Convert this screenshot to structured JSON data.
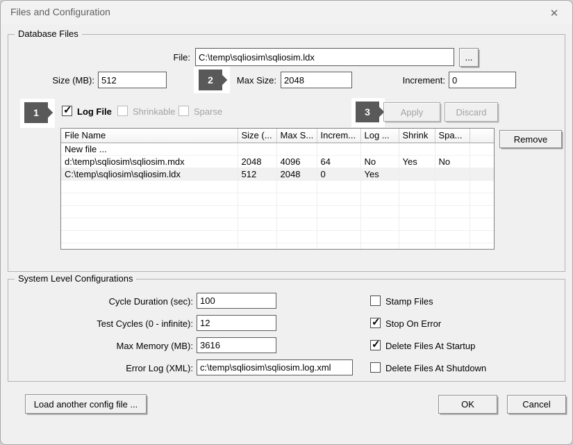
{
  "window": {
    "title": "Files and Configuration",
    "close_glyph": "✕"
  },
  "callouts": {
    "one": "1",
    "two": "2",
    "three": "3"
  },
  "database_files": {
    "group_label": "Database Files",
    "file_label": "File:",
    "file_value": "C:\\temp\\sqliosim\\sqliosim.ldx",
    "browse_label": "...",
    "size_label": "Size (MB):",
    "size_value": "512",
    "max_size_label": "Max Size:",
    "max_size_value": "2048",
    "increment_label": "Increment:",
    "increment_value": "0",
    "log_file_label": "Log File",
    "shrinkable_label": "Shrinkable",
    "sparse_label": "Sparse",
    "apply_label": "Apply",
    "discard_label": "Discard",
    "remove_label": "Remove",
    "table": {
      "columns": [
        "File Name",
        "Size (...",
        "Max S...",
        "Increm...",
        "Log ...",
        "Shrink",
        "Spa...",
        ""
      ],
      "rows": [
        {
          "cells": [
            "New file ...",
            "",
            "",
            "",
            "",
            "",
            "",
            ""
          ],
          "selected": false
        },
        {
          "cells": [
            "d:\\temp\\sqliosim\\sqliosim.mdx",
            "2048",
            "4096",
            "64",
            "No",
            "Yes",
            "No",
            ""
          ],
          "selected": false
        },
        {
          "cells": [
            "C:\\temp\\sqliosim\\sqliosim.ldx",
            "512",
            "2048",
            "0",
            "Yes",
            "",
            "",
            ""
          ],
          "selected": true
        }
      ]
    }
  },
  "system_config": {
    "group_label": "System Level Configurations",
    "fields": [
      {
        "label": "Cycle Duration (sec):",
        "value": "100"
      },
      {
        "label": "Test Cycles (0 - infinite):",
        "value": "12"
      },
      {
        "label": "Max Memory (MB):",
        "value": "3616"
      },
      {
        "label": "Error Log (XML):",
        "value": "c:\\temp\\sqliosim\\sqliosim.log.xml"
      }
    ],
    "checkboxes": [
      {
        "label": "Stamp Files",
        "checked": false
      },
      {
        "label": "Stop On Error",
        "checked": true
      },
      {
        "label": "Delete Files At Startup",
        "checked": true
      },
      {
        "label": "Delete Files At Shutdown",
        "checked": false
      }
    ]
  },
  "footer": {
    "load_label": "Load another config file ...",
    "ok_label": "OK",
    "cancel_label": "Cancel"
  },
  "colors": {
    "dialog_bg": "#f0f0f0",
    "badge_bg": "#595959",
    "selected_row_bg": "#f1f1f1",
    "disabled_text": "#a3a3a3",
    "title_text": "#5f5f5f"
  }
}
